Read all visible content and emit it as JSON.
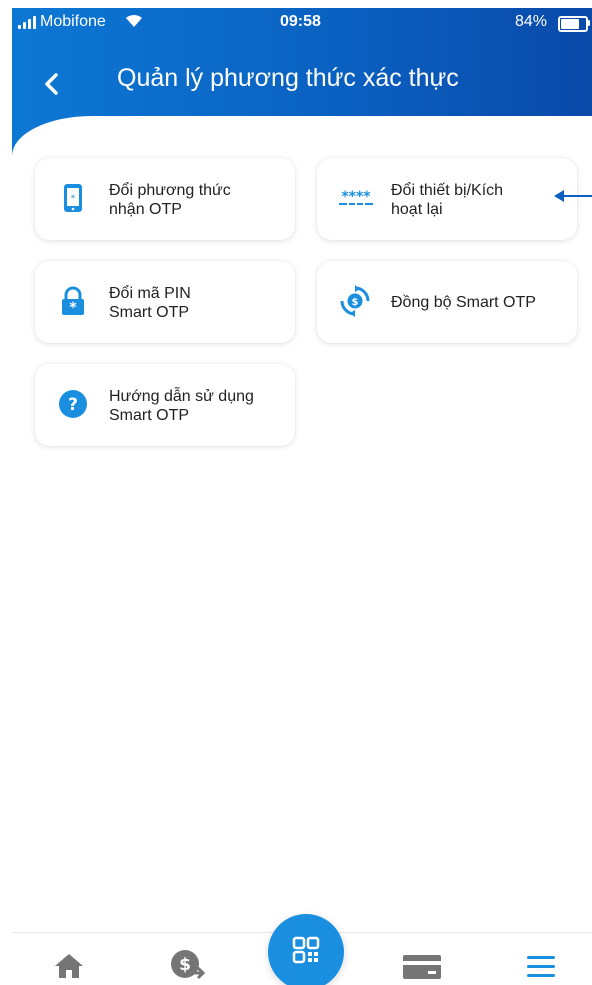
{
  "status_bar": {
    "carrier": "Mobifone",
    "time": "09:58",
    "battery_percent": "84%",
    "battery_level": 0.84
  },
  "header": {
    "title": "Quản lý phương thức xác thực",
    "back_icon": "chevron-left-icon"
  },
  "menu": {
    "items": [
      {
        "line1": "Đổi phương thức",
        "line2": "nhận OTP",
        "icon": "phone-icon"
      },
      {
        "line1": "Đổi thiết bị/Kích",
        "line2": "hoạt lại",
        "icon": "password-stars-icon"
      },
      {
        "line1": "Đổi mã PIN",
        "line2": "Smart OTP",
        "icon": "lock-icon"
      },
      {
        "line1": "Đồng bộ Smart OTP",
        "icon": "sync-icon"
      },
      {
        "line1": "Hướng dẫn sử dụng",
        "line2": "Smart OTP",
        "icon": "help-icon"
      }
    ]
  },
  "bottom_nav": {
    "items": [
      "home-icon",
      "money-transfer-icon",
      "qr-scan-icon",
      "card-icon",
      "menu-icon"
    ]
  },
  "colors": {
    "primary": "#0a5fc0",
    "accent": "#1a8fe0",
    "icon_gray": "#757575"
  }
}
